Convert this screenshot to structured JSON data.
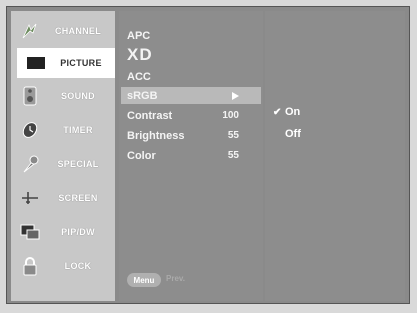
{
  "sidebar": {
    "items": [
      {
        "label": "CHANNEL",
        "icon": "channel-icon"
      },
      {
        "label": "PICTURE",
        "icon": "picture-icon",
        "active": true
      },
      {
        "label": "SOUND",
        "icon": "sound-icon"
      },
      {
        "label": "TIMER",
        "icon": "timer-icon"
      },
      {
        "label": "SPECIAL",
        "icon": "special-icon"
      },
      {
        "label": "SCREEN",
        "icon": "screen-icon"
      },
      {
        "label": "PIP/DW",
        "icon": "pip-icon"
      },
      {
        "label": "LOCK",
        "icon": "lock-icon"
      }
    ]
  },
  "menu": {
    "items": [
      {
        "label": "APC",
        "value": ""
      },
      {
        "label": "XD",
        "value": ""
      },
      {
        "label": "ACC",
        "value": ""
      },
      {
        "label": "sRGB",
        "value": "",
        "selected": true
      },
      {
        "label": "Contrast",
        "value": "100"
      },
      {
        "label": "Brightness",
        "value": "55"
      },
      {
        "label": "Color",
        "value": "55"
      }
    ],
    "footer_button": "Menu",
    "footer_text": "Prev."
  },
  "submenu": {
    "options": [
      {
        "label": "On",
        "checked": true
      },
      {
        "label": "Off",
        "checked": false
      }
    ]
  },
  "colors": {
    "background": "#d9d9d9",
    "panel": "#8d8d8d",
    "sidebar": "#c8c8c8",
    "highlight": "#b9b9b9"
  }
}
